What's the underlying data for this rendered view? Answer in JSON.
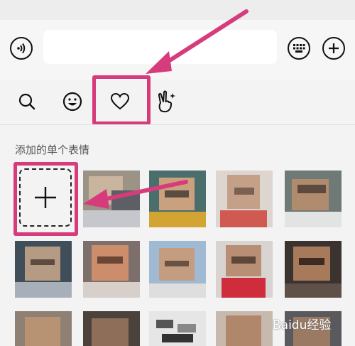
{
  "toolbar": {
    "voice_icon": "voice-icon",
    "keyboard_icon": "keyboard-icon",
    "plus_icon": "plus-icon",
    "input_value": ""
  },
  "tabs": [
    {
      "name": "search",
      "icon": "search-icon"
    },
    {
      "name": "emoji",
      "icon": "smiley-icon"
    },
    {
      "name": "favorites",
      "icon": "heart-icon",
      "selected": true
    },
    {
      "name": "stickers",
      "icon": "victory-hand-icon"
    }
  ],
  "section": {
    "title": "添加的单个表情"
  },
  "add_button": {
    "icon": "plus-icon"
  },
  "watermark": {
    "text": "Baidu经验"
  },
  "colors": {
    "highlight": "#d63c7b",
    "background": "#f3f3f3"
  }
}
